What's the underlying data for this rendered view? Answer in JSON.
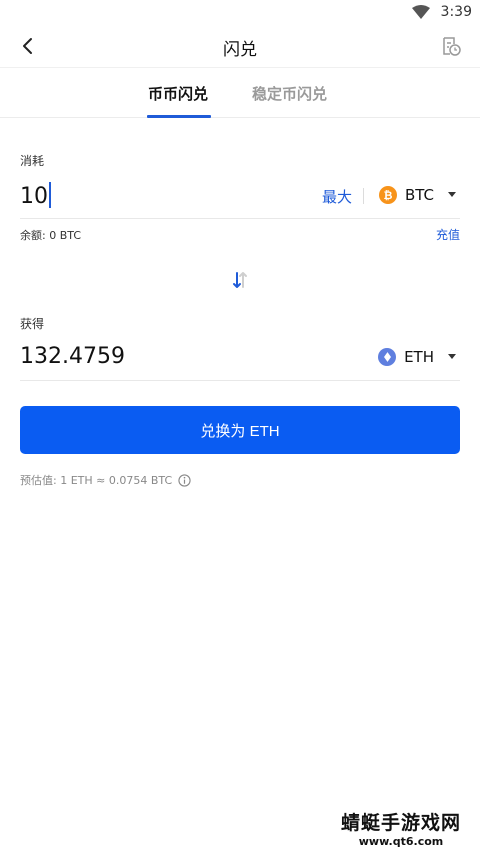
{
  "status_bar": {
    "time": "3:39"
  },
  "header": {
    "title": "闪兑"
  },
  "tabs": [
    {
      "label": "币币闪兑",
      "active": true
    },
    {
      "label": "稳定币闪兑",
      "active": false
    }
  ],
  "pay": {
    "label": "消耗",
    "value": "10",
    "max_label": "最大",
    "coin": "BTC",
    "balance": "余额: 0 BTC",
    "recharge_label": "充值"
  },
  "receive": {
    "label": "获得",
    "value": "132.4759",
    "coin": "ETH"
  },
  "convert_button": "兑换为 ETH",
  "estimate": "预估值:  1 ETH ≈ 0.0754 BTC",
  "colors": {
    "accent": "#1f5bd8",
    "button": "#0a5cf2",
    "btc": "#f7931a",
    "eth": "#5f7fdf"
  },
  "watermark": {
    "title": "蜻蜓手游戏网",
    "url": "www.qt6.com"
  }
}
